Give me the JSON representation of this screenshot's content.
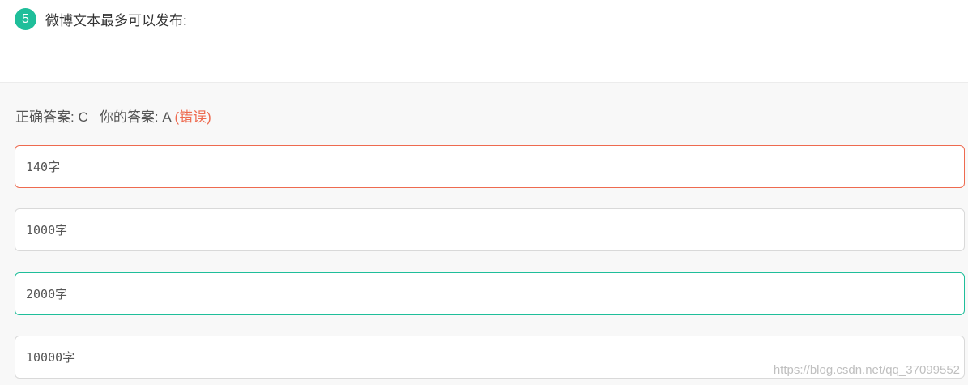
{
  "question": {
    "number": "5",
    "text": "微博文本最多可以发布:"
  },
  "result": {
    "correct_label": "正确答案: C",
    "your_label": "你的答案: A",
    "status": "(错误)"
  },
  "options": [
    {
      "label": "140字",
      "state": "selected-wrong"
    },
    {
      "label": "1000字",
      "state": "normal"
    },
    {
      "label": "2000字",
      "state": "correct"
    },
    {
      "label": "10000字",
      "state": "normal"
    }
  ],
  "watermark": "https://blog.csdn.net/qq_37099552",
  "colors": {
    "accent_green": "#1fbe9a",
    "error_red": "#ee6a4f"
  }
}
